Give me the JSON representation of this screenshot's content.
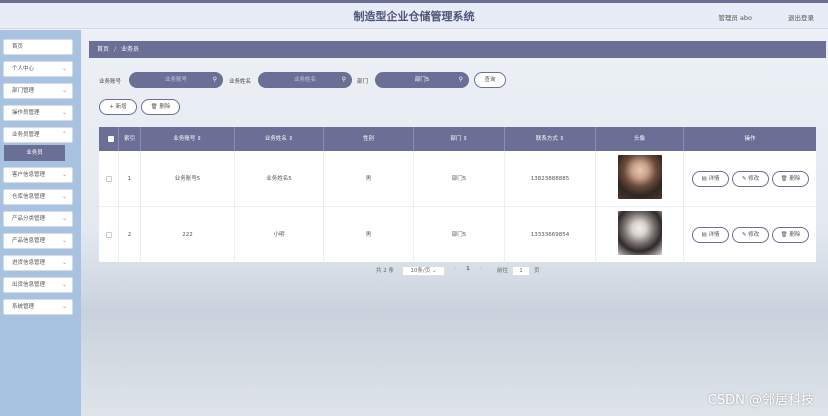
{
  "header": {
    "title": "制造型企业仓储管理系统",
    "user": "管理员 abo",
    "logout": "退出登录"
  },
  "sidebar": {
    "items": [
      {
        "label": "首页",
        "expandable": false
      },
      {
        "label": "个人中心",
        "expandable": true
      },
      {
        "label": "部门管理",
        "expandable": true
      },
      {
        "label": "操作员管理",
        "expandable": true
      },
      {
        "label": "业务员管理",
        "expandable": true
      },
      {
        "label": "客户信息管理",
        "expandable": true
      },
      {
        "label": "仓库信息管理",
        "expandable": true
      },
      {
        "label": "产品分类管理",
        "expandable": true
      },
      {
        "label": "产品信息管理",
        "expandable": true
      },
      {
        "label": "进货信息管理",
        "expandable": true
      },
      {
        "label": "出货信息管理",
        "expandable": true
      },
      {
        "label": "系统管理",
        "expandable": true
      }
    ],
    "active_sub": "业务员"
  },
  "breadcrumb": {
    "home": "首页",
    "sep": "/",
    "current": "业务员"
  },
  "search": {
    "account_label": "业务账号",
    "account_placeholder": "业务账号",
    "name_label": "业务姓名",
    "name_placeholder": "业务姓名",
    "dept_label": "部门",
    "dept_value": "部门5",
    "query_label": "查询"
  },
  "actions": {
    "add_label": "+ 新增",
    "delete_label": "删除"
  },
  "table": {
    "columns": [
      "索引",
      "业务账号 ⇕",
      "业务姓名 ⇕",
      "性别",
      "部门 ⇕",
      "联系方式 ⇕",
      "头像",
      "操作"
    ],
    "rows": [
      {
        "index": "1",
        "account": "业务账号5",
        "name": "业务姓名5",
        "gender": "男",
        "dept": "部门5",
        "phone": "13823888885"
      },
      {
        "index": "2",
        "account": "222",
        "name": "小明",
        "gender": "男",
        "dept": "部门5",
        "phone": "13333669854"
      }
    ],
    "op_labels": {
      "detail": "详情",
      "edit": "修改",
      "delete": "删除"
    }
  },
  "pagination": {
    "total": "共 2 条",
    "page_size": "10条/页",
    "prev": "‹",
    "current_page": "1",
    "next": "›",
    "goto_label": "前往",
    "goto_value": "1",
    "page_suffix": "页"
  },
  "watermark": "CSDN @邻居科技"
}
